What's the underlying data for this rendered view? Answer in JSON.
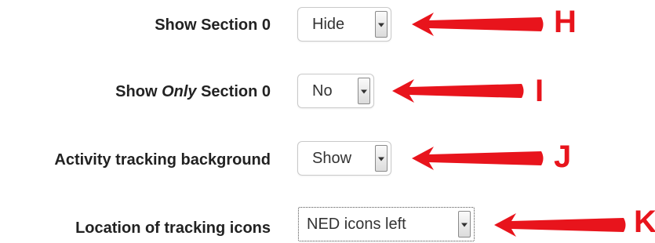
{
  "settings": [
    {
      "label_parts": [
        "Show Section 0"
      ],
      "value": "Hide",
      "annotation": "H"
    },
    {
      "label_parts": [
        "Show ",
        "Only",
        " Section 0"
      ],
      "value": "No",
      "annotation": "I"
    },
    {
      "label_parts": [
        "Activity tracking background"
      ],
      "value": "Show",
      "annotation": "J"
    },
    {
      "label_parts": [
        "Location of tracking icons"
      ],
      "value": "NED icons left",
      "annotation": "K"
    }
  ],
  "icons": {
    "dropdown": "chevron-down-icon",
    "annotation_arrow": "arrow-left-icon"
  },
  "colors": {
    "annotation": "#e8141c",
    "label": "#222222"
  }
}
